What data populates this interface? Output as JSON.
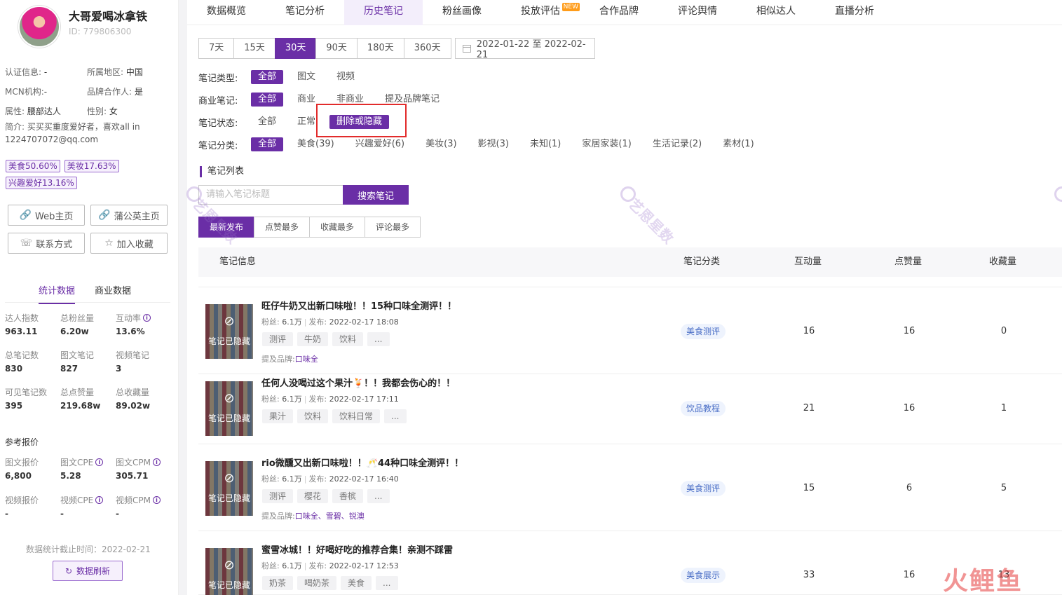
{
  "profile": {
    "name": "大哥爱喝冰拿铁",
    "id": "ID: 779806300",
    "info": [
      {
        "label": "认证信息:",
        "value": " -"
      },
      {
        "label": "所属地区:",
        "value": " 中国"
      },
      {
        "label": "MCN机构:",
        "value": "-"
      },
      {
        "label": "品牌合作人:",
        "value": " 是"
      },
      {
        "label": "属性:",
        "value": " 腰部达人"
      },
      {
        "label": "性别:",
        "value": " 女"
      }
    ],
    "bio_label": "简介:",
    "bio_text": " 买买买重度爱好者，喜欢all in 1224707072@qq.com",
    "tags": [
      "美食50.60%",
      "美妆17.63%",
      "兴趣爱好13.16%"
    ],
    "buttons": {
      "web": "Web主页",
      "pugongying": "蒲公英主页",
      "contact": "联系方式",
      "favorite": "加入收藏"
    }
  },
  "stat_tabs": [
    "统计数据",
    "商业数据"
  ],
  "stats": [
    {
      "label": "达人指数",
      "value": "963.11",
      "info": false
    },
    {
      "label": "总粉丝量",
      "value": "6.20w",
      "info": false
    },
    {
      "label": "互动率",
      "value": "13.6%",
      "info": true
    },
    {
      "label": "总笔记数",
      "value": "830",
      "info": false
    },
    {
      "label": "图文笔记",
      "value": "827",
      "info": false
    },
    {
      "label": "视频笔记",
      "value": "3",
      "info": false
    },
    {
      "label": "可见笔记数",
      "value": "395",
      "info": false
    },
    {
      "label": "总点赞量",
      "value": "219.68w",
      "info": false
    },
    {
      "label": "总收藏量",
      "value": "89.02w",
      "info": false
    }
  ],
  "quote_title": "参考报价",
  "quotes": [
    {
      "label": "图文报价",
      "value": "6,800",
      "info": false
    },
    {
      "label": "图文CPE",
      "value": "5.28",
      "info": true
    },
    {
      "label": "图文CPM",
      "value": "305.71",
      "info": true
    },
    {
      "label": "视频报价",
      "value": "-",
      "info": false
    },
    {
      "label": "视频CPE",
      "value": "-",
      "info": true
    },
    {
      "label": "视频CPM",
      "value": "-",
      "info": true
    }
  ],
  "cutoff": "数据统计截止时间：2022-02-21",
  "refresh": "数据刷新",
  "nav": [
    {
      "label": "数据概览",
      "active": false,
      "badge": ""
    },
    {
      "label": "笔记分析",
      "active": false,
      "badge": ""
    },
    {
      "label": "历史笔记",
      "active": true,
      "badge": ""
    },
    {
      "label": "粉丝画像",
      "active": false,
      "badge": ""
    },
    {
      "label": "投放评估",
      "active": false,
      "badge": "NEW"
    },
    {
      "label": "合作品牌",
      "active": false,
      "badge": ""
    },
    {
      "label": "评论舆情",
      "active": false,
      "badge": ""
    },
    {
      "label": "相似达人",
      "active": false,
      "badge": ""
    },
    {
      "label": "直播分析",
      "active": false,
      "badge": ""
    }
  ],
  "days": [
    "7天",
    "15天",
    "30天",
    "90天",
    "180天",
    "360天"
  ],
  "days_active": 2,
  "date_range": "2022-01-22  至  2022-02-21",
  "filters": [
    {
      "label": "笔记类型:",
      "options": [
        "全部",
        "图文",
        "视频"
      ],
      "active": 0
    },
    {
      "label": "商业笔记:",
      "options": [
        "全部",
        "商业",
        "非商业",
        "提及品牌笔记"
      ],
      "active": 0
    },
    {
      "label": "笔记状态:",
      "options": [
        "全部",
        "正常",
        "删除或隐藏"
      ],
      "active": 2
    },
    {
      "label": "笔记分类:",
      "options": [
        "全部",
        "美食(39)",
        "兴趣爱好(6)",
        "美妆(3)",
        "影视(3)",
        "未知(1)",
        "家居家装(1)",
        "生活记录(2)",
        "素材(1)"
      ],
      "active": 0
    }
  ],
  "section_title": "笔记列表",
  "search": {
    "placeholder": "请输入笔记标题",
    "button": "搜索笔记"
  },
  "sorts": [
    "最新发布",
    "点赞最多",
    "收藏最多",
    "评论最多"
  ],
  "sorts_active": 0,
  "table_headers": {
    "info": "笔记信息",
    "category": "笔记分类",
    "interactions": "互动量",
    "likes": "点赞量",
    "collects": "收藏量"
  },
  "hidden_label": "笔记已隐藏",
  "meta_labels": {
    "fans": "粉丝:",
    "published": "发布:",
    "brand": "提及品牌:"
  },
  "notes": [
    {
      "title": "旺仔牛奶又出新口味啦！！15种口味全测评！！",
      "fans": "6.1万",
      "published": "2022-02-17 18:08",
      "tags": [
        "测评",
        "牛奶",
        "饮料",
        "..."
      ],
      "brand": "口味全",
      "category": "美食测评",
      "interactions": "16",
      "likes": "16",
      "collects": "0"
    },
    {
      "title": "任何人没喝过这个果汁🍹！！我都会伤心的！！",
      "fans": "6.1万",
      "published": "2022-02-17 17:11",
      "tags": [
        "果汁",
        "饮料",
        "饮料日常",
        "..."
      ],
      "brand": "",
      "category": "饮品教程",
      "interactions": "21",
      "likes": "16",
      "collects": "1"
    },
    {
      "title": "rio微醺又出新口味啦！！🥂44种口味全测评！！",
      "fans": "6.1万",
      "published": "2022-02-17 16:40",
      "tags": [
        "测评",
        "樱花",
        "香槟",
        "..."
      ],
      "brand": "口味全、雪碧、锐澳",
      "category": "美食测评",
      "interactions": "15",
      "likes": "6",
      "collects": "5"
    },
    {
      "title": "蜜雪冰城！！好喝好吃的推荐合集！亲测不踩雷",
      "fans": "6.1万",
      "published": "2022-02-17 12:53",
      "tags": [
        "奶茶",
        "喝奶茶",
        "美食",
        "..."
      ],
      "brand": "",
      "category": "美食展示",
      "interactions": "33",
      "likes": "16",
      "collects": "13"
    }
  ],
  "watermark": "艺恩星数",
  "logo_watermark": "火鲤鱼"
}
